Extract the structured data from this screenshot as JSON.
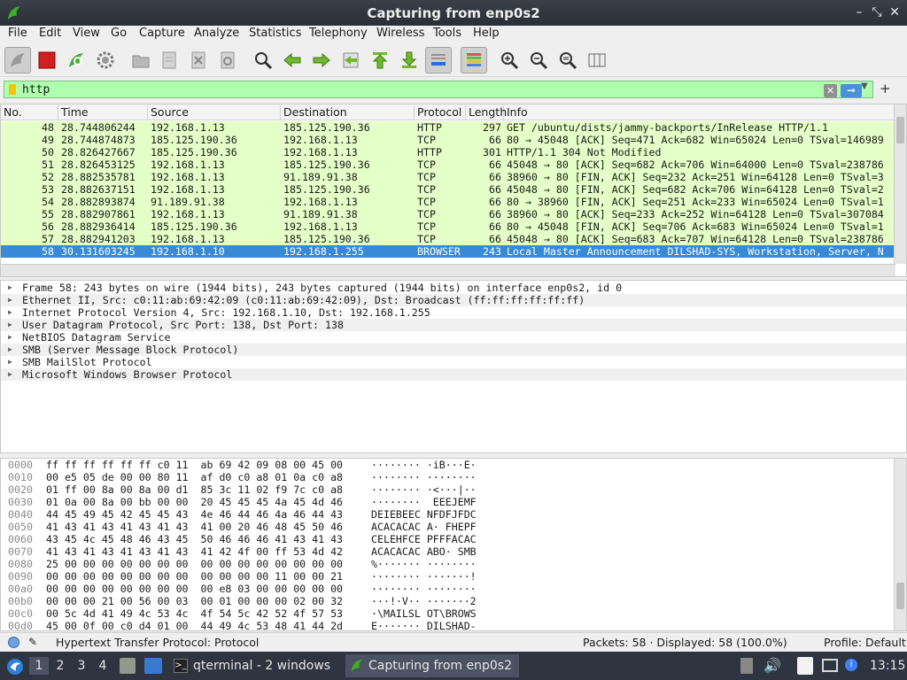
{
  "window": {
    "title": "Capturing from enp0s2"
  },
  "menu": [
    "File",
    "Edit",
    "View",
    "Go",
    "Capture",
    "Analyze",
    "Statistics",
    "Telephony",
    "Wireless",
    "Tools",
    "Help"
  ],
  "filter": {
    "value": "http"
  },
  "columns": [
    "No.",
    "Time",
    "Source",
    "Destination",
    "Protocol",
    "Length",
    "Info"
  ],
  "packets": [
    {
      "no": "48",
      "time": "28.744806244",
      "src": "192.168.1.13",
      "dst": "185.125.190.36",
      "proto": "HTTP",
      "len": "297",
      "info": "GET /ubuntu/dists/jammy-backports/InRelease HTTP/1.1"
    },
    {
      "no": "49",
      "time": "28.744874873",
      "src": "185.125.190.36",
      "dst": "192.168.1.13",
      "proto": "TCP",
      "len": "66",
      "info": "80 → 45048 [ACK] Seq=471 Ack=682 Win=65024 Len=0 TSval=146989"
    },
    {
      "no": "50",
      "time": "28.826427667",
      "src": "185.125.190.36",
      "dst": "192.168.1.13",
      "proto": "HTTP",
      "len": "301",
      "info": "HTTP/1.1 304 Not Modified"
    },
    {
      "no": "51",
      "time": "28.826453125",
      "src": "192.168.1.13",
      "dst": "185.125.190.36",
      "proto": "TCP",
      "len": "66",
      "info": "45048 → 80 [ACK] Seq=682 Ack=706 Win=64000 Len=0 TSval=238786"
    },
    {
      "no": "52",
      "time": "28.882535781",
      "src": "192.168.1.13",
      "dst": "91.189.91.38",
      "proto": "TCP",
      "len": "66",
      "info": "38960 → 80 [FIN, ACK] Seq=232 Ack=251 Win=64128 Len=0 TSval=3"
    },
    {
      "no": "53",
      "time": "28.882637151",
      "src": "192.168.1.13",
      "dst": "185.125.190.36",
      "proto": "TCP",
      "len": "66",
      "info": "45048 → 80 [FIN, ACK] Seq=682 Ack=706 Win=64128 Len=0 TSval=2"
    },
    {
      "no": "54",
      "time": "28.882893874",
      "src": "91.189.91.38",
      "dst": "192.168.1.13",
      "proto": "TCP",
      "len": "66",
      "info": "80 → 38960 [FIN, ACK] Seq=251 Ack=233 Win=65024 Len=0 TSval=1"
    },
    {
      "no": "55",
      "time": "28.882907861",
      "src": "192.168.1.13",
      "dst": "91.189.91.38",
      "proto": "TCP",
      "len": "66",
      "info": "38960 → 80 [ACK] Seq=233 Ack=252 Win=64128 Len=0 TSval=307084"
    },
    {
      "no": "56",
      "time": "28.882936414",
      "src": "185.125.190.36",
      "dst": "192.168.1.13",
      "proto": "TCP",
      "len": "66",
      "info": "80 → 45048 [FIN, ACK] Seq=706 Ack=683 Win=65024 Len=0 TSval=1"
    },
    {
      "no": "57",
      "time": "28.882941203",
      "src": "192.168.1.13",
      "dst": "185.125.190.36",
      "proto": "TCP",
      "len": "66",
      "info": "45048 → 80 [ACK] Seq=683 Ack=707 Win=64128 Len=0 TSval=238786"
    },
    {
      "no": "58",
      "time": "30.131603245",
      "src": "192.168.1.10",
      "dst": "192.168.1.255",
      "proto": "BROWSER",
      "len": "243",
      "info": "Local Master Announcement DILSHAD-SYS, Workstation, Server, N"
    }
  ],
  "details": [
    "Frame 58: 243 bytes on wire (1944 bits), 243 bytes captured (1944 bits) on interface enp0s2, id 0",
    "Ethernet II, Src: c0:11:ab:69:42:09 (c0:11:ab:69:42:09), Dst: Broadcast (ff:ff:ff:ff:ff:ff)",
    "Internet Protocol Version 4, Src: 192.168.1.10, Dst: 192.168.1.255",
    "User Datagram Protocol, Src Port: 138, Dst Port: 138",
    "NetBIOS Datagram Service",
    "SMB (Server Message Block Protocol)",
    "SMB MailSlot Protocol",
    "Microsoft Windows Browser Protocol"
  ],
  "bytes": [
    {
      "off": "0000",
      "hex": "ff ff ff ff ff ff c0 11  ab 69 42 09 08 00 45 00",
      "ascii": "········ ·iB···E·"
    },
    {
      "off": "0010",
      "hex": "00 e5 05 de 00 00 80 11  af d0 c0 a8 01 0a c0 a8",
      "ascii": "········ ········"
    },
    {
      "off": "0020",
      "hex": "01 ff 00 8a 00 8a 00 d1  85 3c 11 02 f9 7c c0 a8",
      "ascii": "········ ·<···|··"
    },
    {
      "off": "0030",
      "hex": "01 0a 00 8a 00 bb 00 00  20 45 45 45 4a 45 4d 46",
      "ascii": "········  EEEJEMF"
    },
    {
      "off": "0040",
      "hex": "44 45 49 45 42 45 45 43  4e 46 44 46 4a 46 44 43",
      "ascii": "DEIEBEEC NFDFJFDC"
    },
    {
      "off": "0050",
      "hex": "41 43 41 43 41 43 41 43  41 00 20 46 48 45 50 46",
      "ascii": "ACACACAC A· FHEPF"
    },
    {
      "off": "0060",
      "hex": "43 45 4c 45 48 46 43 45  50 46 46 46 41 43 41 43",
      "ascii": "CELEHFCE PFFFACAC"
    },
    {
      "off": "0070",
      "hex": "41 43 41 43 41 43 41 43  41 42 4f 00 ff 53 4d 42",
      "ascii": "ACACACAC ABO· SMB"
    },
    {
      "off": "0080",
      "hex": "25 00 00 00 00 00 00 00  00 00 00 00 00 00 00 00",
      "ascii": "%······· ········"
    },
    {
      "off": "0090",
      "hex": "00 00 00 00 00 00 00 00  00 00 00 00 11 00 00 21",
      "ascii": "········ ·······!"
    },
    {
      "off": "00a0",
      "hex": "00 00 00 00 00 00 00 00  00 e8 03 00 00 00 00 00",
      "ascii": "········ ········"
    },
    {
      "off": "00b0",
      "hex": "00 00 00 21 00 56 00 03  00 01 00 00 00 02 00 32",
      "ascii": "···!·V·· ·······2"
    },
    {
      "off": "00c0",
      "hex": "00 5c 4d 41 49 4c 53 4c  4f 54 5c 42 52 4f 57 53",
      "ascii": "·\\MAILSL OT\\BROWS"
    },
    {
      "off": "00d0",
      "hex": "45 00 0f 00 c0 d4 01 00  44 49 4c 53 48 41 44 2d",
      "ascii": "E······· DILSHAD-"
    }
  ],
  "status": {
    "field": "Hypertext Transfer Protocol: Protocol",
    "packets": "Packets: 58 · Displayed: 58 (100.0%)",
    "profile": "Profile: Default"
  },
  "taskbar": {
    "workspaces": [
      "1",
      "2",
      "3",
      "4"
    ],
    "tasks": [
      "qterminal - 2 windows",
      "Capturing from enp0s2"
    ],
    "clock": "13:15"
  },
  "colors": {
    "http_row": "#e4ffc7",
    "selected_row": "#3889d6",
    "filter_ok": "#afffaf",
    "taskbar": "#2e3440"
  }
}
